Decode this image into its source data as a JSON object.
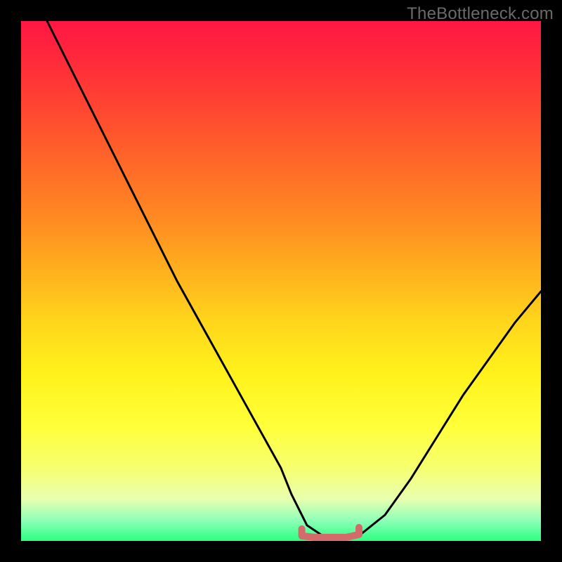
{
  "watermark": "TheBottleneck.com",
  "colors": {
    "frame": "#000000",
    "curve": "#000000",
    "marker": "#d46a6a"
  },
  "chart_data": {
    "type": "line",
    "title": "",
    "xlabel": "",
    "ylabel": "",
    "xlim": [
      0,
      100
    ],
    "ylim": [
      0,
      100
    ],
    "grid": false,
    "series": [
      {
        "name": "bottleneck-curve",
        "x": [
          5,
          10,
          15,
          20,
          25,
          30,
          35,
          40,
          45,
          50,
          52,
          55,
          58,
          60,
          62,
          65,
          70,
          75,
          80,
          85,
          90,
          95,
          100
        ],
        "y": [
          100,
          90,
          80,
          70,
          60,
          50,
          41,
          32,
          23,
          14,
          9,
          3,
          1,
          0.5,
          0.5,
          1,
          5,
          12,
          20,
          28,
          35,
          42,
          48
        ]
      }
    ],
    "annotations": [
      {
        "name": "optimal-range-marker",
        "x_start": 54,
        "x_end": 65,
        "y": 1.5,
        "color": "#d46a6a"
      }
    ]
  }
}
